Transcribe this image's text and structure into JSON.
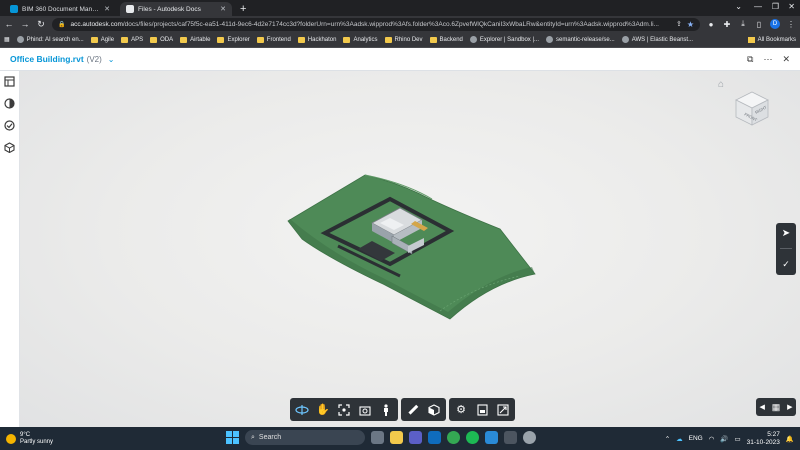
{
  "browser": {
    "tabs": [
      {
        "label": "BIM 360 Document Manageme",
        "active": false
      },
      {
        "label": "Files - Autodesk Docs",
        "active": true
      }
    ],
    "url_domain": "acc.autodesk.com",
    "url_rest": "/docs/files/projects/caf75f5c-ea51-411d-9ec6-4d2e7174cc3d?folderUrn=urn%3Aadsk.wipprod%3Afs.folder%3Aco.6ZpvefWlQkCaniI3xWbaLRw&entityId=urn%3Aadsk.wipprod%3Adm.li...",
    "profile_initial": "D",
    "bookmarks": [
      {
        "label": "Phind: AI search en...",
        "kind": "site"
      },
      {
        "label": "Agile",
        "kind": "folder"
      },
      {
        "label": "APS",
        "kind": "folder"
      },
      {
        "label": "ODA",
        "kind": "folder"
      },
      {
        "label": "Airtable",
        "kind": "folder"
      },
      {
        "label": "Explorer",
        "kind": "folder"
      },
      {
        "label": "Frontend",
        "kind": "folder"
      },
      {
        "label": "Hackhaton",
        "kind": "folder"
      },
      {
        "label": "Analytics",
        "kind": "folder"
      },
      {
        "label": "Rhino Dev",
        "kind": "folder"
      },
      {
        "label": "Backend",
        "kind": "folder"
      },
      {
        "label": "Explorer | Sandbox |...",
        "kind": "site"
      },
      {
        "label": "semantic-release/se...",
        "kind": "site"
      },
      {
        "label": "AWS | Elastic Beanst...",
        "kind": "site"
      }
    ],
    "all_bookmarks": "All Bookmarks"
  },
  "app": {
    "doc_title": "Office Building.rvt",
    "doc_version": "(V2)"
  },
  "viewcube": {
    "top": "FRONT",
    "right": "RIGHT"
  },
  "taskbar": {
    "weather_temp": "9°C",
    "weather_desc": "Partly sunny",
    "search_placeholder": "Search",
    "language": "ENG",
    "time": "5:27",
    "date": "31-10-2023"
  },
  "colors": {
    "accent": "#0696d7",
    "toolbar_bg": "#2e3338",
    "terrain": "#4e8a57"
  }
}
